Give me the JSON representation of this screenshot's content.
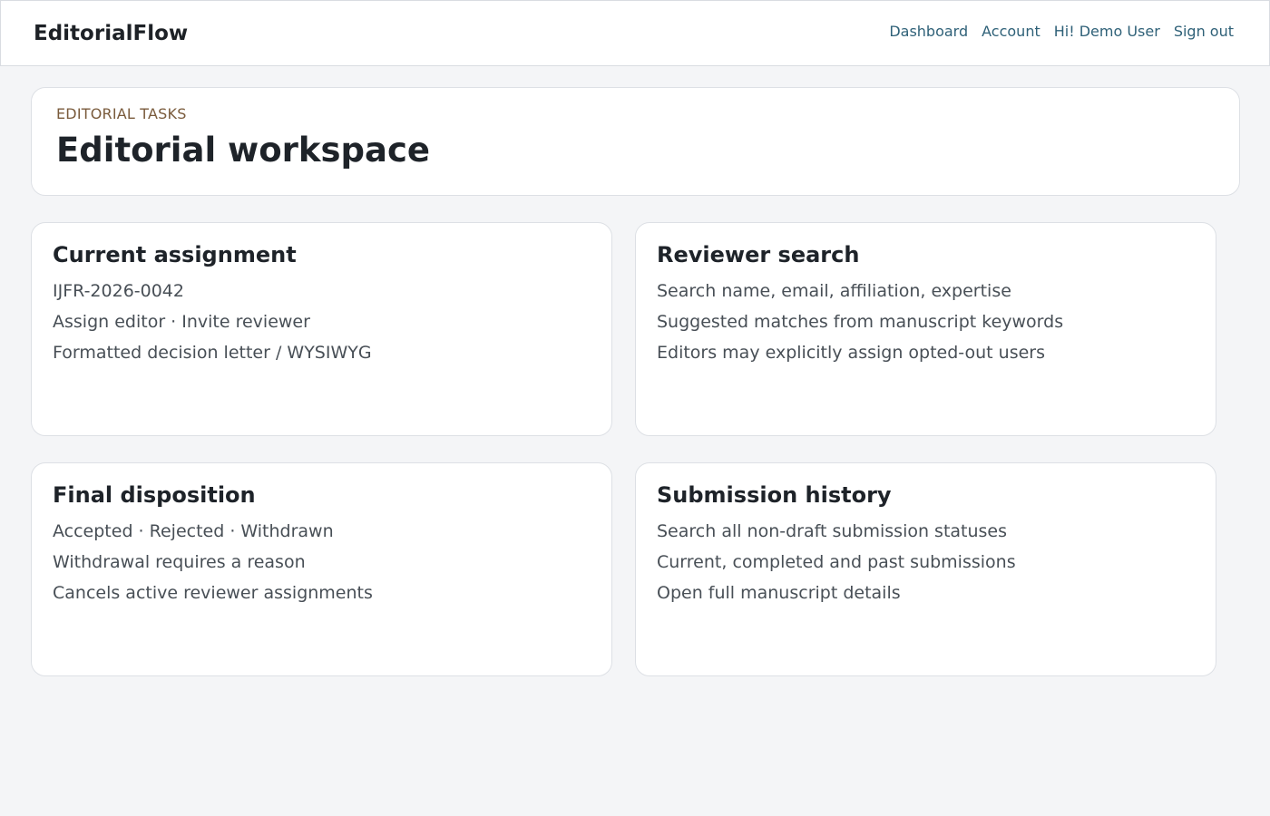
{
  "header": {
    "brand": "EditorialFlow",
    "nav": [
      "Dashboard",
      "Account",
      "Hi! Demo User",
      "Sign out"
    ]
  },
  "hero": {
    "eyebrow": "EDITORIAL TASKS",
    "title": "Editorial workspace"
  },
  "cards": [
    {
      "title": "Current assignment",
      "lines": [
        "IJFR-2026-0042",
        "Assign editor · Invite reviewer",
        "Formatted decision letter / WYSIWYG"
      ]
    },
    {
      "title": "Reviewer search",
      "lines": [
        "Search name, email, affiliation, expertise",
        "Suggested matches from manuscript keywords",
        "Editors may explicitly assign opted-out users"
      ]
    },
    {
      "title": "Final disposition",
      "lines": [
        "Accepted · Rejected · Withdrawn",
        "Withdrawal requires a reason",
        "Cancels active reviewer assignments"
      ]
    },
    {
      "title": "Submission history",
      "lines": [
        "Search all non-draft submission statuses",
        "Current, completed and past submissions",
        "Open full manuscript details"
      ]
    }
  ],
  "colors": {
    "background": "#f4f5f7",
    "link": "#2f6178",
    "eyebrow": "#7a5b3c"
  }
}
